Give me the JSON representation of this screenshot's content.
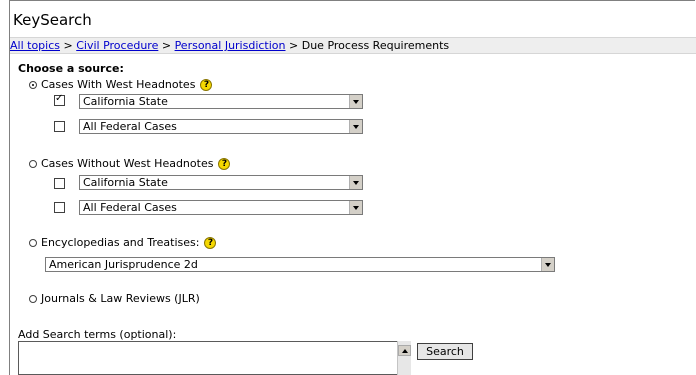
{
  "title": "KeySearch",
  "breadcrumb": {
    "items": [
      "All topics",
      "Civil Procedure",
      "Personal Jurisdiction"
    ],
    "separator": ">",
    "current": "Due Process Requirements"
  },
  "choose_label": "Choose a source:",
  "sources": {
    "headnotes": {
      "label": "Cases With West Headnotes",
      "selected": true,
      "options": [
        {
          "checked": true,
          "value": "California State"
        },
        {
          "checked": false,
          "value": "All Federal Cases"
        }
      ]
    },
    "without": {
      "label": "Cases Without West Headnotes",
      "selected": false,
      "options": [
        {
          "checked": false,
          "value": "California State"
        },
        {
          "checked": false,
          "value": "All Federal Cases"
        }
      ]
    },
    "encyclopedias": {
      "label": "Encyclopedias and Treatises:",
      "selected": false,
      "value": "American Jurisprudence 2d"
    },
    "journals": {
      "label": "Journals & Law Reviews (JLR)",
      "selected": false
    }
  },
  "search_terms": {
    "label": "Add Search terms (optional):",
    "value": "",
    "button": "Search"
  },
  "icons": {
    "help": "help-icon",
    "dropdown": "dropdown-arrow-icon"
  },
  "colors": {
    "link": "#0000cc",
    "help_icon": "#f5d800",
    "breadcrumb_bg": "#eeeeee"
  }
}
